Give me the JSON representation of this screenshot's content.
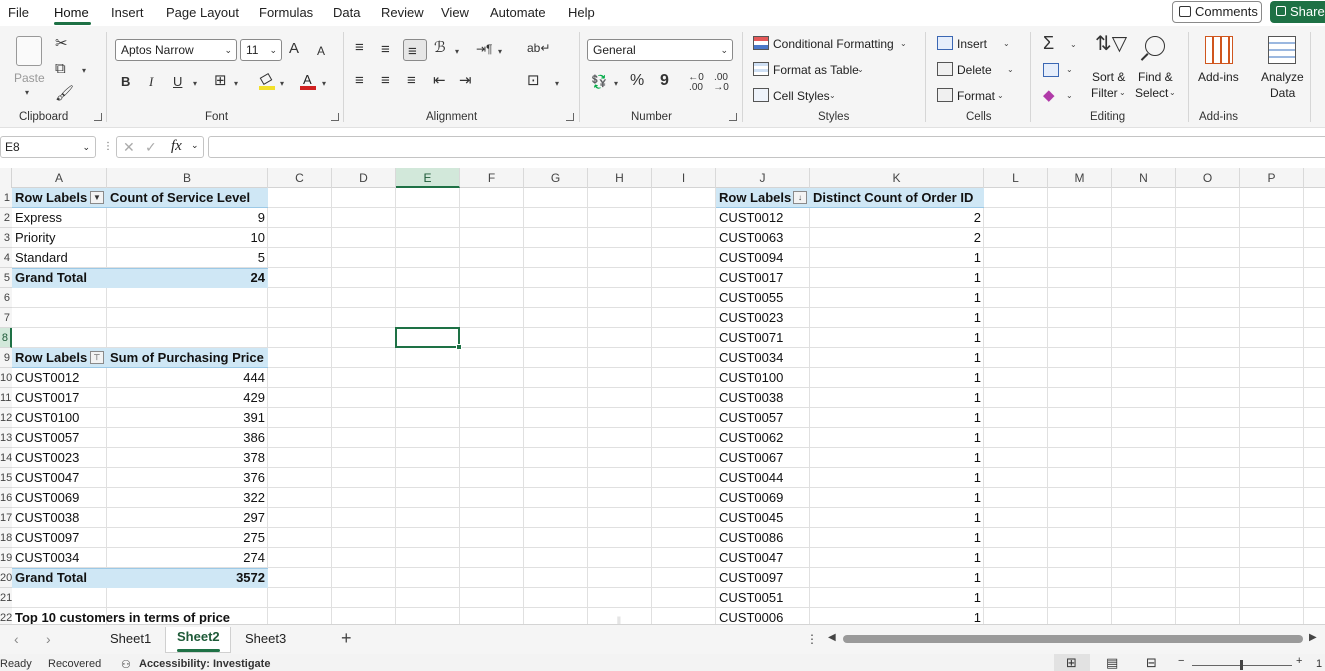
{
  "menu": {
    "items": [
      "File",
      "Home",
      "Insert",
      "Page Layout",
      "Formulas",
      "Data",
      "Review",
      "View",
      "Automate",
      "Help"
    ],
    "active": "Home",
    "comments_label": "Comments",
    "share_label": "Share"
  },
  "ribbon": {
    "clipboard": {
      "label": "Clipboard",
      "paste": "Paste"
    },
    "font": {
      "label": "Font",
      "font_name": "Aptos Narrow",
      "font_size": "11",
      "grow": "A",
      "shrink": "A",
      "bold": "B",
      "italic": "I",
      "underline": "U"
    },
    "alignment": {
      "label": "Alignment"
    },
    "number": {
      "label": "Number",
      "format": "General",
      "percent": "%",
      "comma": "9"
    },
    "styles": {
      "label": "Styles",
      "conditional": "Conditional Formatting",
      "format_table": "Format as Table",
      "cell_styles": "Cell Styles"
    },
    "cells": {
      "label": "Cells",
      "insert": "Insert",
      "delete": "Delete",
      "format": "Format"
    },
    "editing": {
      "label": "Editing",
      "sum": "Σ",
      "sort_filter_1": "Sort &",
      "sort_filter_2": "Filter",
      "find_select_1": "Find &",
      "find_select_2": "Select"
    },
    "addins": {
      "label": "Add-ins",
      "addins": "Add-ins",
      "analyze_1": "Analyze",
      "analyze_2": "Data"
    }
  },
  "formula_bar": {
    "name_box": "E8",
    "fx": "fx",
    "value": ""
  },
  "columns": [
    "A",
    "B",
    "C",
    "D",
    "E",
    "F",
    "G",
    "H",
    "I",
    "J",
    "K",
    "L",
    "M",
    "N",
    "O",
    "P"
  ],
  "rows": [
    "1",
    "2",
    "3",
    "4",
    "5",
    "6",
    "7",
    "8",
    "9",
    "10",
    "11",
    "12",
    "13",
    "14",
    "15",
    "16",
    "17",
    "18",
    "19",
    "20",
    "21",
    "22"
  ],
  "pivot1": {
    "headers": [
      "Row Labels",
      "Count of Service Level"
    ],
    "rows": [
      [
        "Express",
        "9"
      ],
      [
        "Priority",
        "10"
      ],
      [
        "Standard",
        "5"
      ]
    ],
    "total": [
      "Grand Total",
      "24"
    ]
  },
  "pivot2": {
    "headers": [
      "Row Labels",
      "Sum of Purchasing Price"
    ],
    "rows": [
      [
        "CUST0012",
        "444"
      ],
      [
        "CUST0017",
        "429"
      ],
      [
        "CUST0100",
        "391"
      ],
      [
        "CUST0057",
        "386"
      ],
      [
        "CUST0023",
        "378"
      ],
      [
        "CUST0047",
        "376"
      ],
      [
        "CUST0069",
        "322"
      ],
      [
        "CUST0038",
        "297"
      ],
      [
        "CUST0097",
        "275"
      ],
      [
        "CUST0034",
        "274"
      ]
    ],
    "total": [
      "Grand Total",
      "3572"
    ]
  },
  "note_a22": "Top 10 customers in terms of price",
  "pivot3": {
    "headers": [
      "Row Labels",
      "Distinct Count of Order ID"
    ],
    "rows": [
      [
        "CUST0012",
        "2"
      ],
      [
        "CUST0063",
        "2"
      ],
      [
        "CUST0094",
        "1"
      ],
      [
        "CUST0017",
        "1"
      ],
      [
        "CUST0055",
        "1"
      ],
      [
        "CUST0023",
        "1"
      ],
      [
        "CUST0071",
        "1"
      ],
      [
        "CUST0034",
        "1"
      ],
      [
        "CUST0100",
        "1"
      ],
      [
        "CUST0038",
        "1"
      ],
      [
        "CUST0057",
        "1"
      ],
      [
        "CUST0062",
        "1"
      ],
      [
        "CUST0067",
        "1"
      ],
      [
        "CUST0044",
        "1"
      ],
      [
        "CUST0069",
        "1"
      ],
      [
        "CUST0045",
        "1"
      ],
      [
        "CUST0086",
        "1"
      ],
      [
        "CUST0047",
        "1"
      ],
      [
        "CUST0097",
        "1"
      ],
      [
        "CUST0051",
        "1"
      ],
      [
        "CUST0006",
        "1"
      ]
    ]
  },
  "sheets": [
    "Sheet1",
    "Sheet2",
    "Sheet3"
  ],
  "active_sheet": "Sheet2",
  "status": {
    "ready": "Ready",
    "recovered": "Recovered",
    "accessibility": "Accessibility: Investigate",
    "zoom": "1"
  },
  "watermark": "خمسات"
}
